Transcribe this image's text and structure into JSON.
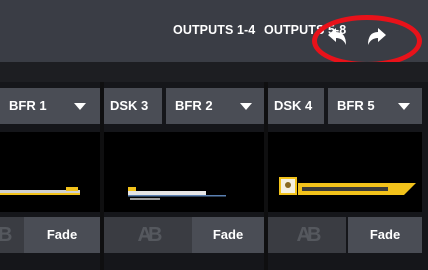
{
  "header": {
    "tabs": [
      {
        "label": "OUTPUTS 1-4"
      },
      {
        "label": "OUTPUTS 5-8"
      }
    ],
    "undo_icon": "undo-arrow-icon",
    "redo_icon": "redo-arrow-icon",
    "callout_color": "#e8121a"
  },
  "panels": [
    {
      "dsk_label": "",
      "buffer_label": "BFR 1",
      "transition_label": "Fade",
      "ab_glyph": "AB"
    },
    {
      "dsk_label": "DSK 3",
      "buffer_label": "BFR 2",
      "transition_label": "Fade",
      "ab_glyph": "AB"
    },
    {
      "dsk_label": "DSK 4",
      "buffer_label": "BFR 5",
      "transition_label": "Fade",
      "ab_glyph": "AB"
    }
  ],
  "colors": {
    "topbar": "#3a3d45",
    "button": "#4a4d55",
    "highlight": "#e8121a",
    "lower_third_accent": "#f2c21b"
  }
}
